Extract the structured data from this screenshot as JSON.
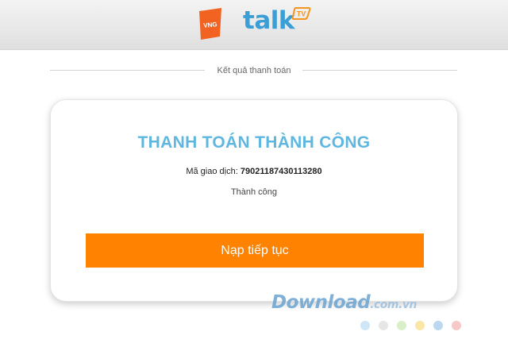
{
  "header": {
    "vng_logo_text": "VNG",
    "app_logo_text": "talk",
    "app_logo_badge": "TV"
  },
  "section": {
    "title": "Kết quả thanh toán"
  },
  "result": {
    "heading": "THANH TOÁN THÀNH CÔNG",
    "transaction_label": "Mã giao dịch:",
    "transaction_id": "79021187430113280",
    "status_text": "Thành công",
    "button_label": "Nạp tiếp tục"
  },
  "watermark": {
    "text": "Download",
    "suffix": ".com.vn",
    "dot_colors": [
      "#cfe6f6",
      "#e6e6e6",
      "#d9efc8",
      "#fbe6a8",
      "#bcd8f1",
      "#f6c8c8"
    ]
  },
  "colors": {
    "vng_orange": "#f26322",
    "talk_blue": "#3b9fd6",
    "tv_orange": "#f7941d",
    "heading_blue": "#5fb7e0",
    "button_orange": "#ff8200"
  }
}
